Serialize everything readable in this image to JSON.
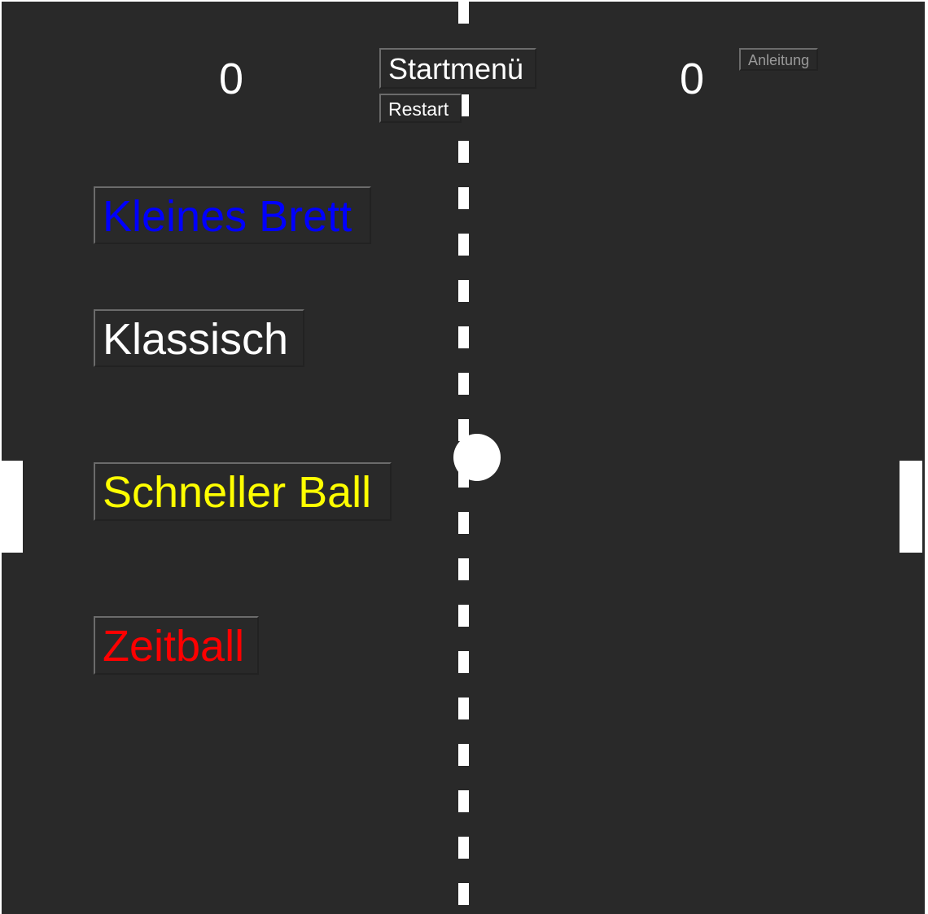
{
  "scores": {
    "left": "0",
    "right": "0"
  },
  "toolbar": {
    "startmenu_label": "Startmenü",
    "restart_label": "Restart",
    "instructions_label": "Anleitung"
  },
  "modes": [
    {
      "label": "Kleines Brett",
      "color": "#0000ff"
    },
    {
      "label": "Klassisch",
      "color": "#ffffff"
    },
    {
      "label": "Schneller Ball",
      "color": "#ffff00"
    },
    {
      "label": "Zeitball",
      "color": "#ff0000"
    }
  ],
  "colors": {
    "field_background": "#292929",
    "foreground": "#ffffff"
  }
}
